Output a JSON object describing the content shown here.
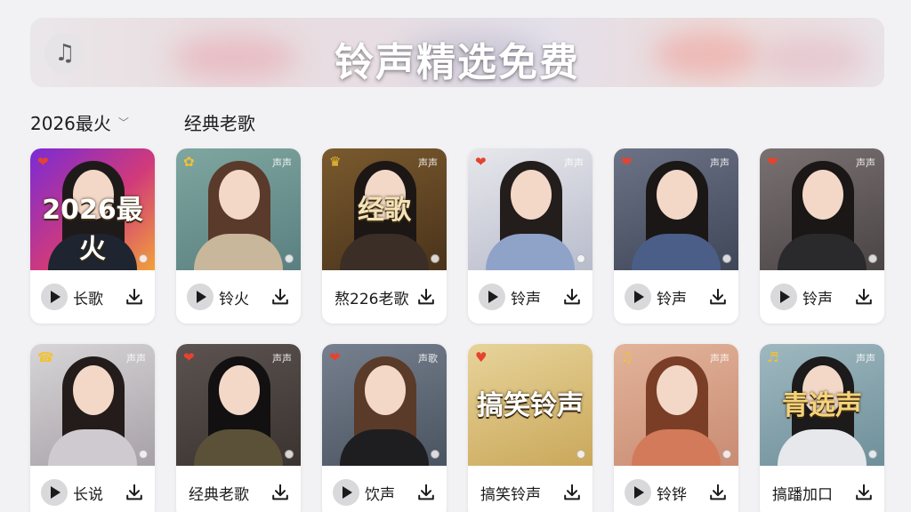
{
  "header": {
    "title": "铃声精选免费",
    "logo_icon": "music-note-icon"
  },
  "tabs": [
    {
      "label": "2026最火",
      "has_dropdown": true
    },
    {
      "label": "经典老歌",
      "has_dropdown": false
    }
  ],
  "cards": [
    {
      "thumb_title": "2026最火",
      "tl": "❤",
      "tr": "",
      "label": "长歌",
      "play": true,
      "bg": "linear-gradient(135deg,#7a2bd6,#d13a7a 55%,#f2a13a)",
      "hair": "#1f1a1a",
      "body": "#1e2430",
      "thumb_color": "#ffffff"
    },
    {
      "thumb_title": "",
      "tl": "✿",
      "tr": "声声",
      "label": "铃火",
      "play": true,
      "bg": "linear-gradient(160deg,#7fa6a0,#5a7f80)",
      "hair": "#5a3a2a",
      "body": "#c8b79a"
    },
    {
      "thumb_title": "经歌",
      "tl": "♛",
      "tr": "声声",
      "label": "熬226老歌",
      "play": false,
      "bg": "linear-gradient(160deg,#7a5a2e,#4a331a)",
      "hair": "#1c1715",
      "body": "#3a2e26",
      "thumb_color": "#f4e2b8"
    },
    {
      "thumb_title": "",
      "tl": "❤",
      "tr": "声声",
      "label": "铃声",
      "play": true,
      "bg": "linear-gradient(160deg,#e7e7ec,#b8bccb)",
      "hair": "#231d1c",
      "body": "#8fa3c9"
    },
    {
      "thumb_title": "",
      "tl": "❤",
      "tr": "声声",
      "label": "铃声",
      "play": true,
      "bg": "linear-gradient(160deg,#6c7386,#3f4658)",
      "hair": "#1b1716",
      "body": "#4a5e88"
    },
    {
      "thumb_title": "",
      "tl": "❤",
      "tr": "声声",
      "label": "铃声",
      "play": true,
      "bg": "linear-gradient(160deg,#7a7272,#4b4444)",
      "hair": "#1b1716",
      "body": "#2a2a2c"
    },
    {
      "thumb_title": "",
      "tl": "☎",
      "tr": "声声",
      "label": "长说",
      "play": true,
      "bg": "linear-gradient(160deg,#d7d5d8,#a7a1a7)",
      "hair": "#231c1a",
      "body": "#cfcad0"
    },
    {
      "thumb_title": "",
      "tl": "❤",
      "tr": "声声",
      "label": "经典老歌",
      "play": false,
      "bg": "linear-gradient(160deg,#5c5350,#3a3330)",
      "hair": "#121010",
      "body": "#5b5138"
    },
    {
      "thumb_title": "",
      "tl": "❤",
      "tr": "声歌",
      "label": "饮声",
      "play": true,
      "bg": "linear-gradient(160deg,#77808e,#4a5360)",
      "hair": "#5a3a28",
      "body": "#1e1e20"
    },
    {
      "thumb_title": "搞笑铃声",
      "tl": "♥",
      "tr": "",
      "label": "搞笑铃声",
      "play": false,
      "bg": "linear-gradient(160deg,#e7d39a,#caa85a)",
      "hair": "transparent",
      "body": "transparent",
      "thumb_color": "#ffffff"
    },
    {
      "thumb_title": "",
      "tl": "♫",
      "tr": "声声",
      "label": "铃铧",
      "play": true,
      "bg": "linear-gradient(160deg,#e2b49a,#c98b73)",
      "hair": "#7a3e26",
      "body": "#d27a5a"
    },
    {
      "thumb_title": "青选声",
      "tl": "♬",
      "tr": "声声",
      "label": "搞蹯加口",
      "play": false,
      "bg": "linear-gradient(160deg,#9fb8c0,#6e8f9a)",
      "hair": "#1c1a1a",
      "body": "#e6e8ec",
      "thumb_color": "#f6d37a"
    }
  ]
}
